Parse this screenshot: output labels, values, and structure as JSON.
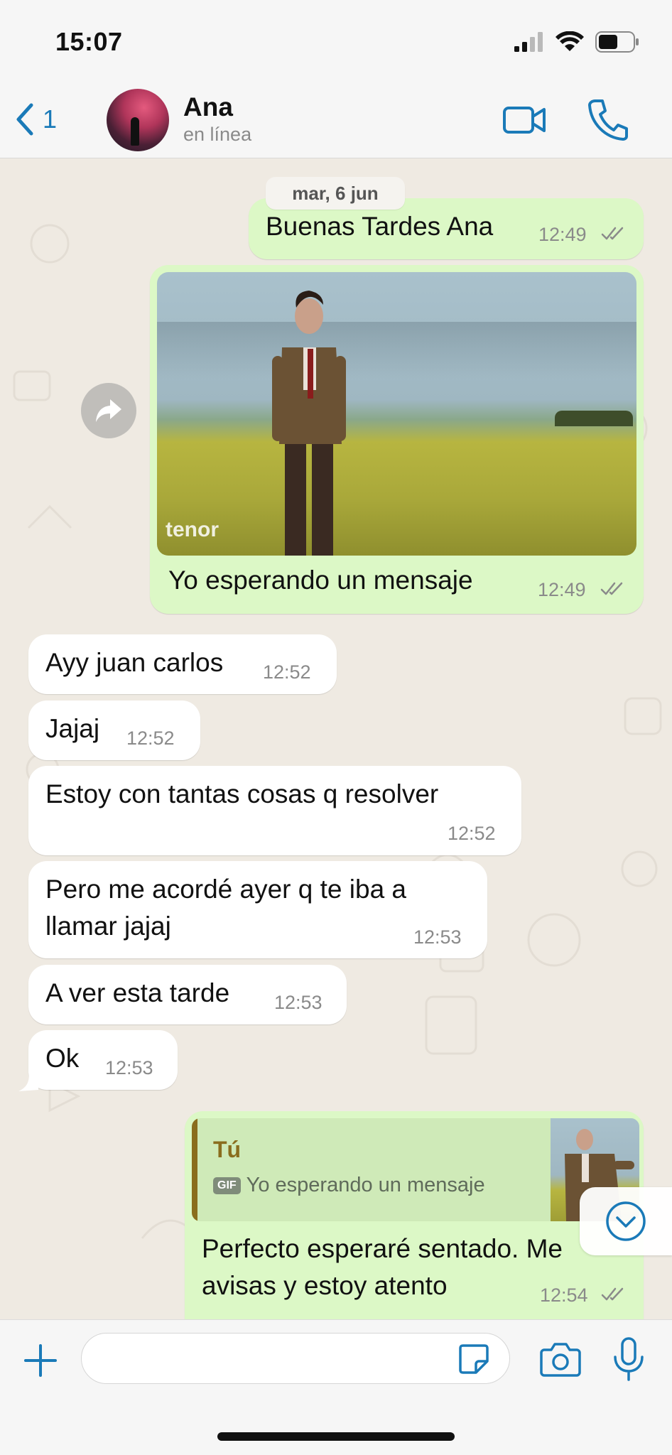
{
  "status_bar": {
    "time": "15:07"
  },
  "header": {
    "back_count": "1",
    "contact_name": "Ana",
    "contact_status": "en línea"
  },
  "chat": {
    "date_label": "mar, 6 jun",
    "messages": [
      {
        "dir": "out",
        "text": "Buenas Tardes Ana",
        "time": "12:49"
      },
      {
        "dir": "out",
        "type": "gif",
        "gif_watermark": "tenor",
        "text": "Yo esperando un mensaje",
        "time": "12:49"
      },
      {
        "dir": "in",
        "text": "Ayy juan carlos",
        "time": "12:52"
      },
      {
        "dir": "in",
        "text": "Jajaj",
        "time": "12:52"
      },
      {
        "dir": "in",
        "text": "Estoy con tantas cosas q resolver",
        "time": "12:52"
      },
      {
        "dir": "in",
        "text": "Pero me acordé ayer q te iba a\nllamar jajaj",
        "time": "12:53"
      },
      {
        "dir": "in",
        "text": "A ver esta tarde",
        "time": "12:53"
      },
      {
        "dir": "in",
        "text": "Ok",
        "time": "12:53"
      },
      {
        "dir": "out",
        "reply_to": {
          "author": "Tú",
          "badge": "GIF",
          "text": "Yo esperando un mensaje"
        },
        "text": "Perfecto esperaré sentado. Me\navisas y estoy atento",
        "time": "12:54"
      }
    ]
  },
  "composer": {
    "placeholder": ""
  },
  "colors": {
    "accent": "#1a7ab8",
    "outgoing_bubble": "#dcf8c6",
    "incoming_bubble": "#ffffff",
    "chat_bg": "#efeae2",
    "quote_author": "#8a6d1d"
  },
  "icons": [
    "back-chevron-icon",
    "video-call-icon",
    "phone-icon",
    "forward-icon",
    "read-ticks-icon",
    "scroll-down-icon",
    "plus-icon",
    "sticker-icon",
    "camera-icon",
    "microphone-icon"
  ]
}
